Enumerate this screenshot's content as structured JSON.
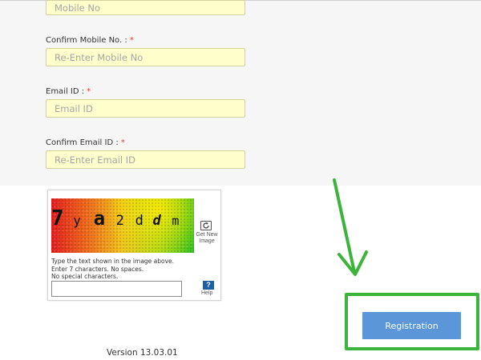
{
  "form": {
    "mobile": {
      "placeholder": "Mobile No"
    },
    "confirm_mobile": {
      "label": "Confirm Mobile No. :",
      "required_mark": "*",
      "placeholder": "Re-Enter Mobile No"
    },
    "email": {
      "label": "Email ID :",
      "required_mark": "*",
      "placeholder": "Email ID"
    },
    "confirm_email": {
      "label": "Confirm Email ID :",
      "required_mark": "*",
      "placeholder": "Re-Enter Email ID"
    }
  },
  "captcha": {
    "chars": [
      "7",
      "y",
      "a",
      "2",
      "d",
      "d",
      "m"
    ],
    "refresh_icon": "refresh-icon",
    "refresh_label": "Get New Image",
    "instructions": [
      "Type the text shown in the image above.",
      "Enter 7 characters. No spaces.",
      "No special characters."
    ],
    "input_value": "",
    "help_icon": "?",
    "help_label": "Help"
  },
  "actions": {
    "register_label": "Registration"
  },
  "annotation": {
    "color": "#3cb43c",
    "arrow_icon": "arrow-down-icon"
  },
  "footer": {
    "version": "Version 13.03.01"
  }
}
